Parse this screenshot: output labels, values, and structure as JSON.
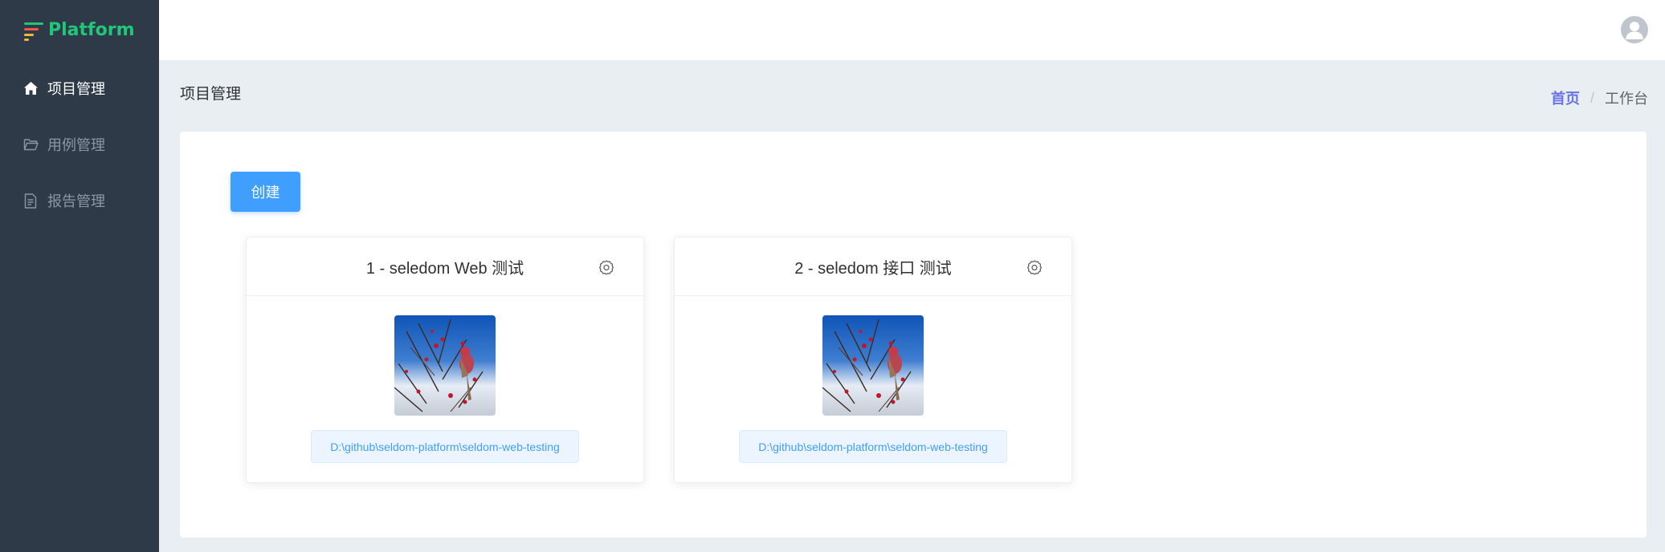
{
  "brand": {
    "name": "Platform"
  },
  "sidebar": {
    "items": [
      {
        "label": "项目管理",
        "icon": "home-icon",
        "active": true
      },
      {
        "label": "用例管理",
        "icon": "folder-icon",
        "active": false
      },
      {
        "label": "报告管理",
        "icon": "document-icon",
        "active": false
      }
    ]
  },
  "header": {
    "avatar_icon": "user-avatar-icon"
  },
  "page": {
    "title": "项目管理"
  },
  "breadcrumb": {
    "home": "首页",
    "separator": "/",
    "current": "工作台"
  },
  "toolbar": {
    "create_label": "创建"
  },
  "projects": [
    {
      "title": "1 - seledom Web 测试",
      "path": "D:\\github\\seldom-platform\\seldom-web-testing",
      "settings_icon": "gear-icon",
      "image": "bird-on-branch-image"
    },
    {
      "title": "2 - seledom 接口 测试",
      "path": "D:\\github\\seldom-platform\\seldom-web-testing",
      "settings_icon": "gear-icon",
      "image": "bird-on-branch-image"
    }
  ],
  "colors": {
    "sidebar_bg": "#2f3a48",
    "brand": "#20c77a",
    "primary": "#409eff",
    "breadcrumb_link": "#6a73e2"
  }
}
